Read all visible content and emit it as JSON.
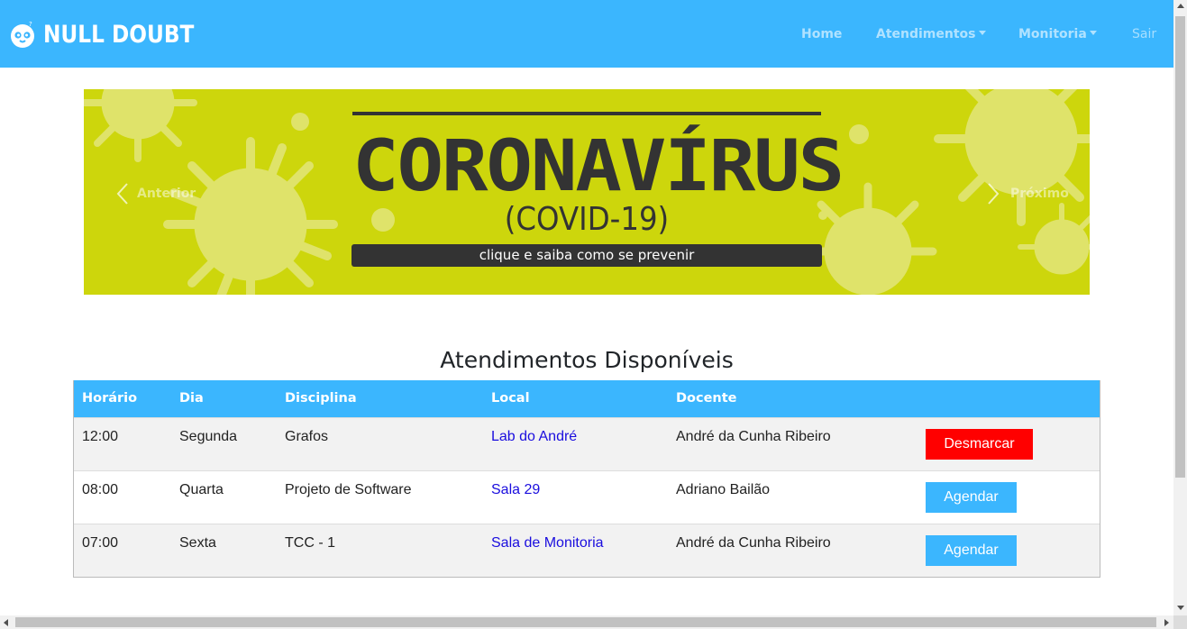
{
  "navbar": {
    "brand": "NULL DOUBT",
    "items": [
      {
        "label": "Home"
      },
      {
        "label": "Atendimentos"
      },
      {
        "label": "Monitoria"
      },
      {
        "label": "Sair"
      }
    ],
    "background": "#3bb6fe"
  },
  "carousel": {
    "title": "CORONAVÍRUS",
    "subtitle": "(COVID-19)",
    "bar_text": "clique e saiba como se prevenir",
    "prev_label": "Anterior",
    "next_label": "Próximo",
    "background": "#cdd60c",
    "decoration_icon": "virus-icon"
  },
  "section": {
    "title": "Atendimentos Disponíveis"
  },
  "table": {
    "headers": [
      "Horário",
      "Dia",
      "Disciplina",
      "Local",
      "Docente"
    ],
    "rows": [
      {
        "horario": "12:00",
        "dia": "Segunda",
        "disciplina": "Grafos",
        "local": "Lab do André",
        "docente": "André da Cunha Ribeiro",
        "action": "Desmarcar",
        "action_color": "#ff0000"
      },
      {
        "horario": "08:00",
        "dia": "Quarta",
        "disciplina": "Projeto de Software",
        "local": "Sala 29",
        "docente": "Adriano Bailão",
        "action": "Agendar",
        "action_color": "#3bb6fe"
      },
      {
        "horario": "07:00",
        "dia": "Sexta",
        "disciplina": "TCC - 1",
        "local": "Sala de Monitoria",
        "docente": "André da Cunha Ribeiro",
        "action": "Agendar",
        "action_color": "#3bb6fe"
      }
    ]
  }
}
